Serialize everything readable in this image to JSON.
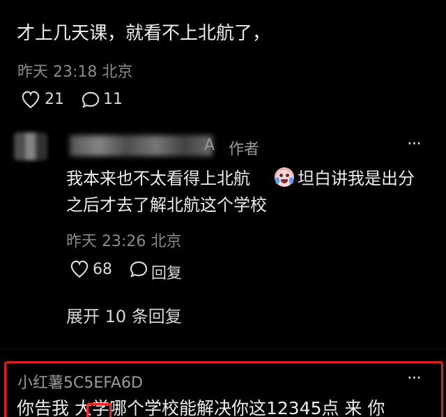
{
  "top_comment": {
    "text": "才上几天课，就看不上北航了，",
    "meta": "昨天 23:18 北京",
    "likes": "21",
    "comments": "11"
  },
  "reply": {
    "author_badge": "作者",
    "name_tail": "A",
    "line1": "我本来也不太看得上北航",
    "line1b": "坦白讲我是出分",
    "line2": "之后才去了解北航这个学校",
    "meta": "昨天 23:26 北京",
    "likes": "68",
    "reply_label": "回复",
    "expand_label": "展开 10 条回复",
    "more": "···"
  },
  "next_comment": {
    "author": "小红薯5C5EFA6D",
    "text": "你告我 大学哪个学校能解决你这12345点 来 你",
    "more": "···"
  },
  "colors": {
    "background": "#000000",
    "text": "#ececec",
    "meta": "#8b8b8b",
    "highlight": "#e0201c"
  },
  "icons": [
    "heart-icon",
    "comment-bubble-icon",
    "more-icon",
    "crying-face-icon"
  ]
}
